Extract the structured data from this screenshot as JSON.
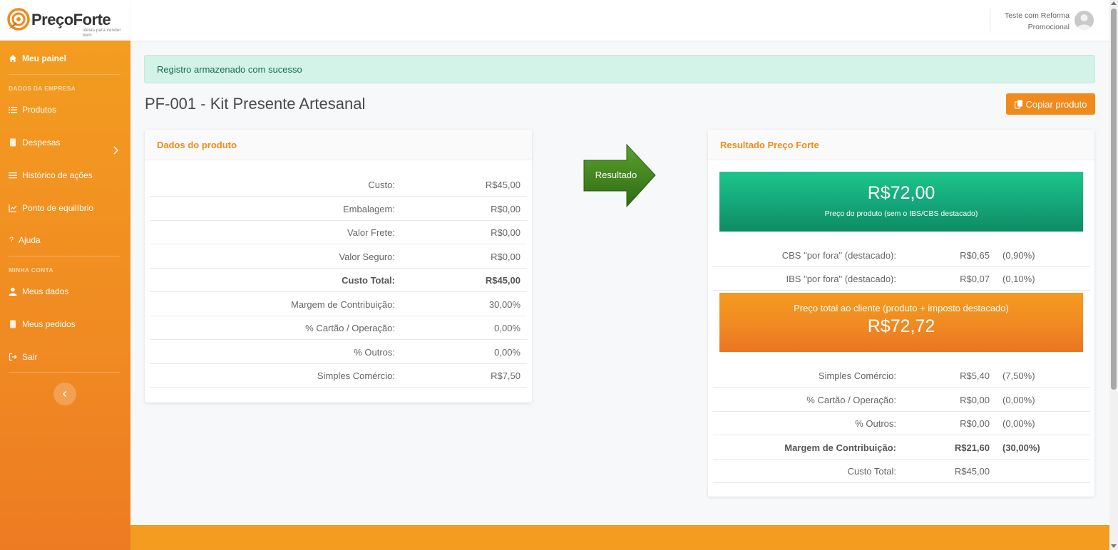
{
  "brand": {
    "name": "PreçoForte",
    "tagline": "ideias para vender bem",
    "accent": "#f08a1c",
    "sidebar_color": "#f39c20",
    "success_bg": "#d3f3e8",
    "result_green": "#14a679"
  },
  "user": {
    "line1": "Teste com Reforma",
    "line2": "Promocional",
    "avatar_icon": "user-avatar-icon"
  },
  "sidebar": {
    "dashboard": {
      "label": "Meu painel",
      "icon": "home-icon"
    },
    "section_company": "DADOS DA EMPRESA",
    "items_company": [
      {
        "label": "Produtos",
        "icon": "list-icon"
      },
      {
        "label": "Despesas",
        "icon": "document-icon"
      },
      {
        "label": "Histórico de ações",
        "icon": "list-icon"
      },
      {
        "label": "Ponto de equilíbrio",
        "icon": "chart-icon"
      },
      {
        "label": "Ajuda",
        "icon": "question-icon"
      }
    ],
    "section_account": "MINHA CONTA",
    "items_account": [
      {
        "label": "Meus dados",
        "icon": "user-icon"
      },
      {
        "label": "Meus pedidos",
        "icon": "document-icon"
      },
      {
        "label": "Sair",
        "icon": "logout-icon"
      }
    ]
  },
  "alert": {
    "text": "Registro armazenado com sucesso"
  },
  "page": {
    "title": "PF-001 - Kit Presente Artesanal",
    "copy_button": "Copiar produto"
  },
  "product_card": {
    "title": "Dados do produto",
    "rows": [
      {
        "label": "Custo:",
        "value": "R$45,00"
      },
      {
        "label": "Embalagem:",
        "value": "R$0,00"
      },
      {
        "label": "Valor Frete:",
        "value": "R$0,00"
      },
      {
        "label": "Valor Seguro:",
        "value": "R$0,00"
      },
      {
        "label": "Custo Total:",
        "value": "R$45,00"
      },
      {
        "label": "Margem de Contribuição:",
        "value": "30,00%"
      },
      {
        "label": "% Cartão / Operação:",
        "value": "0,00%"
      },
      {
        "label": "% Outros:",
        "value": "0,00%"
      },
      {
        "label": "Simples Comércio:",
        "value": "R$7,50"
      }
    ]
  },
  "arrow": {
    "label": "Resultado"
  },
  "result_card": {
    "title": "Resultado Preço Forte",
    "product_price": "R$72,00",
    "product_price_caption": "Preço do produto (sem o IBS/CBS destacado)",
    "tax_rows": [
      {
        "label": "CBS \"por fora\" (destacado):",
        "value": "R$0,65",
        "pct": "(0,90%)"
      },
      {
        "label": "IBS \"por fora\" (destacado):",
        "value": "R$0,07",
        "pct": "(0,10%)"
      }
    ],
    "total_caption": "Preço total ao cliente (produto + imposto destacado)",
    "total_price": "R$72,72",
    "breakdown_rows": [
      {
        "label": "Simples Comércio:",
        "value": "R$5,40",
        "pct": "(7,50%)"
      },
      {
        "label": "% Cartão / Operação:",
        "value": "R$0,00",
        "pct": "(0,00%)"
      },
      {
        "label": "% Outros:",
        "value": "R$0,00",
        "pct": "(0,00%)"
      },
      {
        "label": "Margem de Contribuição:",
        "value": "R$21,60",
        "pct": "(30,00%)"
      },
      {
        "label": "Custo Total:",
        "value": "R$45,00",
        "pct": ""
      }
    ]
  }
}
